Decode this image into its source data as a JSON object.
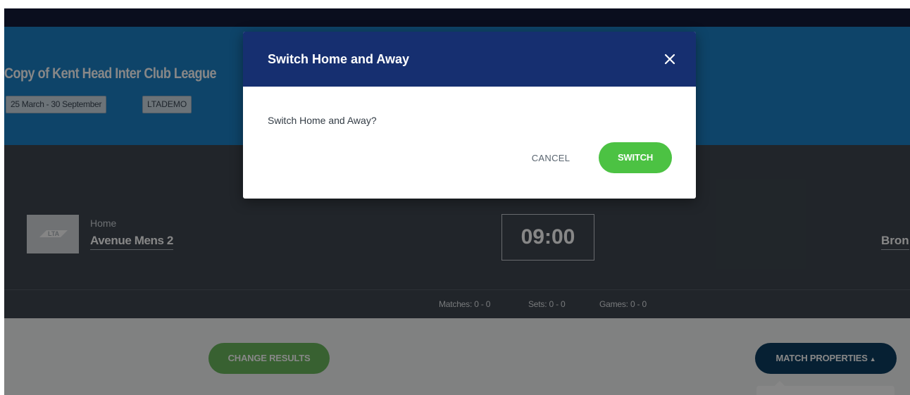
{
  "event": {
    "title": "Copy of Kent Head Inter Club League",
    "dates": "25 March - 30 September",
    "code": "LTADEMO"
  },
  "match": {
    "home_label": "Home",
    "home_team": "Avenue Mens 2",
    "logo_text": "LTA",
    "time": "09:00",
    "away_team": "Bron"
  },
  "scores": {
    "matches": "Matches: 0 - 0",
    "sets": "Sets: 0 - 0",
    "games": "Games: 0 - 0"
  },
  "actions": {
    "change_results": "CHANGE RESULTS",
    "match_properties": "MATCH PROPERTIES",
    "match_properties_caret": "▲"
  },
  "dialog": {
    "title": "Switch Home and Away",
    "close_icon": "close-icon",
    "message": "Switch Home and Away?",
    "cancel_label": "CANCEL",
    "confirm_label": "SWITCH"
  },
  "colors": {
    "topbar": "#131b3a",
    "hero": "#1b80c6",
    "match_band": "#3f4750",
    "dialog_header": "#162f70",
    "switch_button": "#4cc243",
    "change_results_button": "#6bb85e",
    "match_properties_button": "#0d3d60"
  }
}
